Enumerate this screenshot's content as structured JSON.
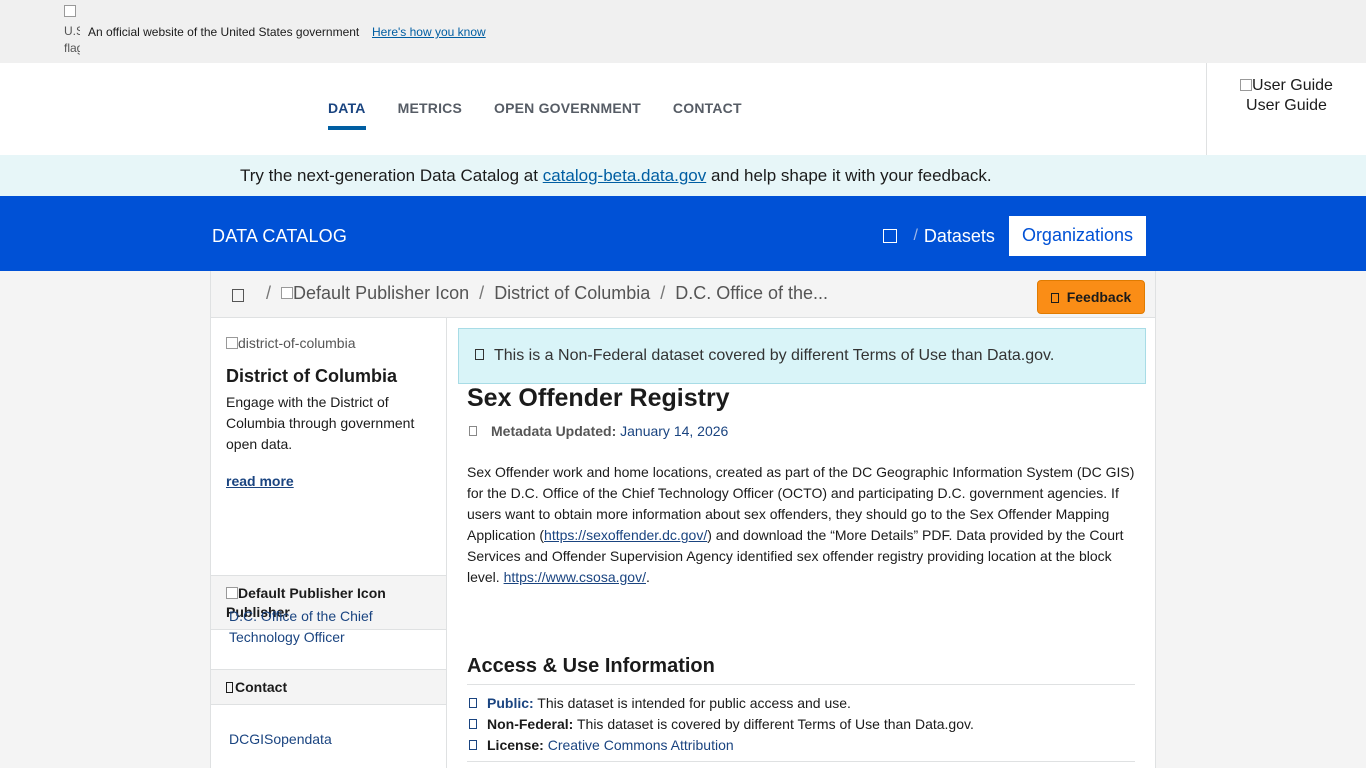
{
  "gov_banner": {
    "flag_alt": "U.S. flag",
    "text": "An official website of the United States government",
    "link": "Here's how you know"
  },
  "nav": {
    "items": [
      "DATA",
      "METRICS",
      "OPEN GOVERNMENT",
      "CONTACT"
    ],
    "active": "DATA",
    "user_guide_img_alt": "User Guide",
    "user_guide_label": "User Guide"
  },
  "beta_banner": {
    "prefix": "Try the next-generation Data Catalog at ",
    "link": "catalog-beta.data.gov",
    "suffix": " and help shape it with your feedback."
  },
  "catalog_bar": {
    "title": "DATA CATALOG",
    "sep": "/",
    "datasets": "Datasets",
    "organizations": "Organizations"
  },
  "breadcrumb": {
    "sep": "/",
    "publisher_icon_alt": "Default Publisher Icon",
    "org": "District of Columbia",
    "office": "D.C. Office of the..."
  },
  "feedback_label": "Feedback",
  "sidebar": {
    "logo_alt": "district-of-columbia",
    "org_name": "District of Columbia",
    "org_desc": "Engage with the District of Columbia through government open data.",
    "read_more": "read more",
    "publisher_icon_alt": "Default Publisher Icon",
    "publisher_heading": "Publisher",
    "publisher_link": "D.C. Office of the Chief Technology Officer",
    "contact_heading": "Contact",
    "contact_link": "DCGISopendata"
  },
  "notice": "This is a Non-Federal dataset covered by different Terms of Use than Data.gov.",
  "dataset": {
    "title": "Sex Offender Registry",
    "meta_label": "Metadata Updated:",
    "meta_date": "January 14, 2026",
    "desc_1": "Sex Offender work and home locations, created as part of the DC Geographic Information System (DC GIS) for the D.C. Office of the Chief Technology Officer (OCTO) and participating D.C. government agencies. If users want to obtain more information about sex offenders, they should go to the Sex Offender Mapping Application (",
    "desc_link_1": "https://sexoffender.dc.gov/",
    "desc_2": ") and download the “More Details” PDF. Data provided by the Court Services and Offender Supervision Agency identified sex offender registry providing location at the block level. ",
    "desc_link_2": "https://www.csosa.gov/",
    "desc_3": "."
  },
  "access": {
    "title": "Access & Use Information",
    "public_label": "Public:",
    "public_text": " This dataset is intended for public access and use.",
    "nonfed_label": "Non-Federal:",
    "nonfed_text": " This dataset is covered by different Terms of Use than Data.gov.",
    "license_label": "License:",
    "license_link": "Creative Commons Attribution"
  }
}
